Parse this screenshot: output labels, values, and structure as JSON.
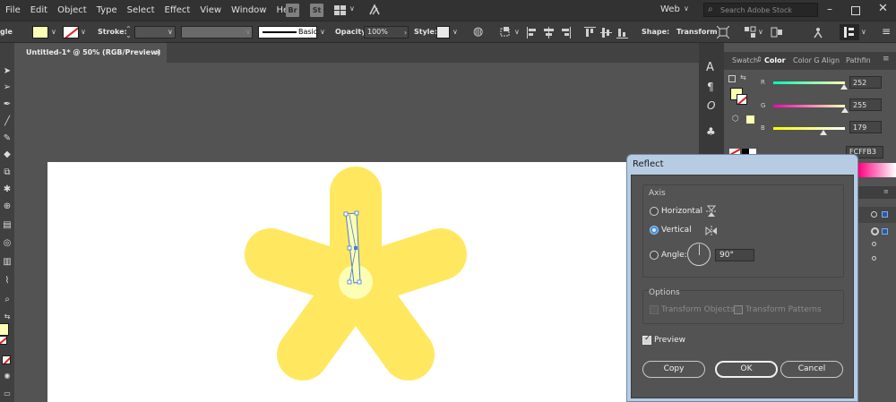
{
  "menubar": {
    "items": [
      "File",
      "Edit",
      "Object",
      "Type",
      "Select",
      "Effect",
      "View",
      "Window",
      "Help"
    ],
    "bridge_badge": "Br",
    "stock_badge": "St",
    "workspace": "Web",
    "search_placeholder": "Search Adobe Stock"
  },
  "controlbar": {
    "truncated_label": "gle",
    "stroke_label": "Stroke:",
    "brush_style": "Basic",
    "opacity_label": "Opacity:",
    "opacity_value": "100%",
    "style_label": "Style:",
    "shape_label": "Shape:",
    "transform_label": "Transform",
    "fill_color": "#FCFFB3"
  },
  "document": {
    "tab_title": "Untitled-1* @ 50% (RGB/Preview)",
    "close_glyph": "×"
  },
  "color_panel": {
    "tabs": [
      "Swatch",
      "Color",
      "Color G",
      "Align",
      "Pathfin"
    ],
    "r_label": "R",
    "g_label": "G",
    "b_label": "B",
    "r_value": "252",
    "g_value": "255",
    "b_value": "179",
    "hex_value": "FCFFB3",
    "r_fraction": 0.988,
    "g_fraction": 1.0,
    "b_fraction": 0.702
  },
  "dialog": {
    "title": "Reflect",
    "axis_label": "Axis",
    "horizontal_label": "Horizontal",
    "vertical_label": "Vertical",
    "angle_label": "Angle:",
    "angle_value": "90°",
    "options_label": "Options",
    "transform_objects_label": "Transform Objects",
    "transform_patterns_label": "Transform Patterns",
    "preview_label": "Preview",
    "copy_label": "Copy",
    "ok_label": "OK",
    "cancel_label": "Cancel"
  },
  "colors": {
    "petal": "#FFE860",
    "center": "#FCFFB3",
    "selection": "#4a7cd6"
  }
}
